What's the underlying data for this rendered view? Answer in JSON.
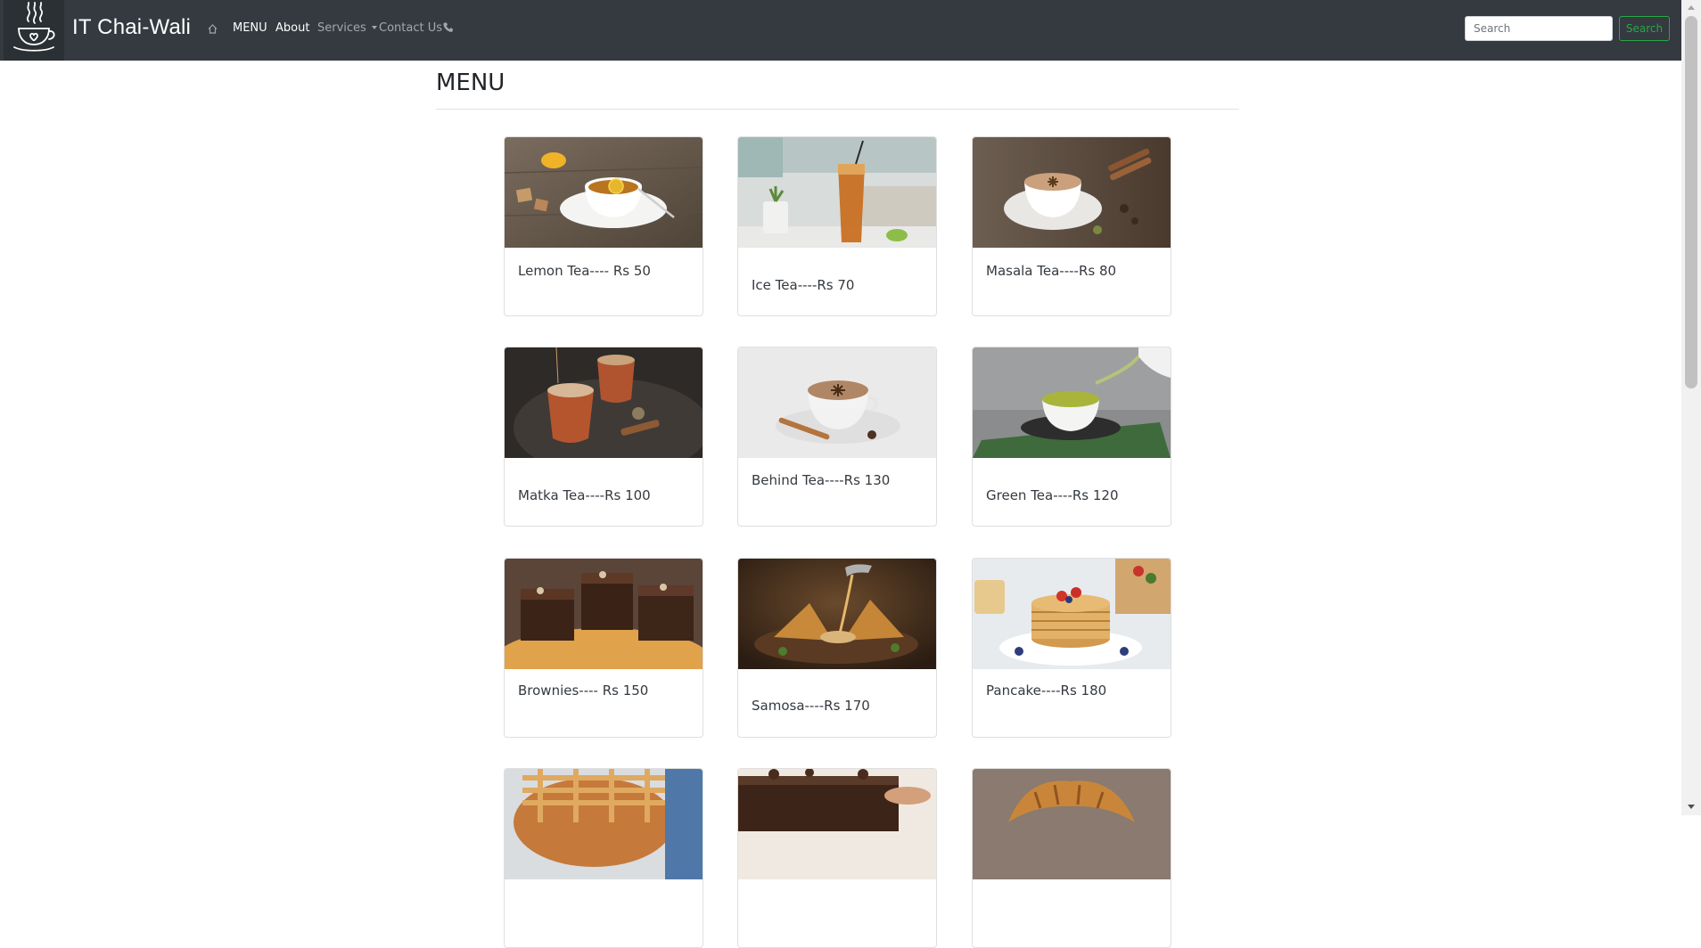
{
  "navbar": {
    "logo_icon": "chai-cup-steam-icon",
    "brand": "IT Chai-Wali",
    "home_icon": "home-icon",
    "items": [
      {
        "label": "MENU",
        "active": true
      },
      {
        "label": "About",
        "active": true
      },
      {
        "label": "Services",
        "dropdown": true
      },
      {
        "label": "Contact Us",
        "icon": "phone-icon"
      }
    ],
    "search": {
      "placeholder": "Search",
      "button_label": "Search"
    }
  },
  "main": {
    "title": "MENU",
    "cards": [
      {
        "label": "Lemon Tea---- Rs 50"
      },
      {
        "label": "Ice Tea----Rs 70"
      },
      {
        "label": "Masala Tea----Rs 80"
      },
      {
        "label": "Matka Tea----Rs 100"
      },
      {
        "label": "Behind Tea----Rs 130"
      },
      {
        "label": "Green Tea----Rs 120"
      },
      {
        "label": "Brownies---- Rs 150"
      },
      {
        "label": "Samosa----Rs 170"
      },
      {
        "label": "Pancake----Rs 180"
      },
      {
        "label": ""
      },
      {
        "label": ""
      },
      {
        "label": ""
      }
    ]
  },
  "colors": {
    "navbar_bg": "#343a40",
    "search_button": "#28a745",
    "nav_active": "#ffffff",
    "nav_inactive": "rgba(255,255,255,0.55)"
  }
}
